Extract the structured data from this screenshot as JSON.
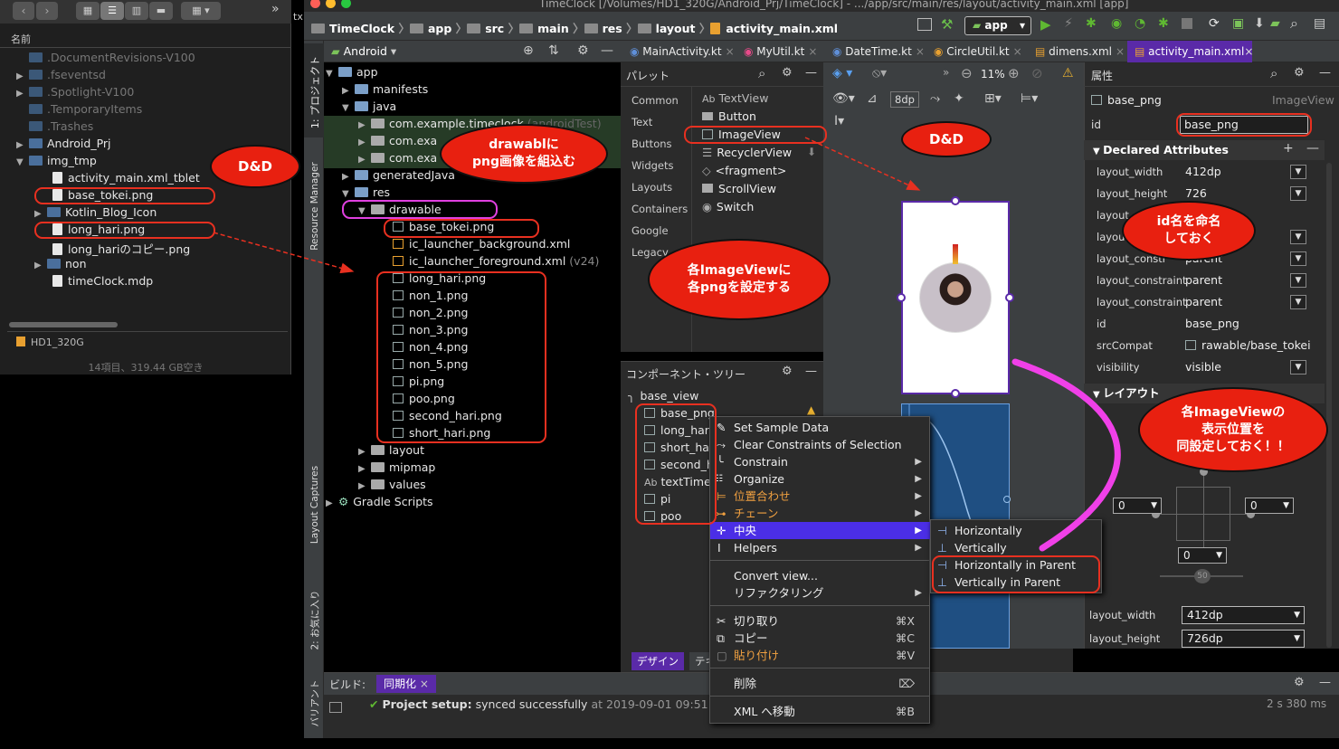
{
  "window_title": "TimeClock [/Volumes/HD1_320G/Android_Prj/TimeClock] - .../app/src/main/res/layout/activity_main.xml [app]",
  "finder": {
    "header": "名前",
    "items": [
      ".DocumentRevisions-V100",
      ".fseventsd",
      ".Spotlight-V100",
      ".TemporaryItems",
      ".Trashes",
      "Android_Prj",
      "img_tmp",
      "activity_main.xml_tblet",
      "base_tokei.png",
      "Kotlin_Blog_Icon",
      "long_hari.png",
      "long_hariのコピー.png",
      "non",
      "timeClock.mdp"
    ],
    "drive": "HD1_320G",
    "status": "14項目、319.44 GB空き",
    "tx": "tx"
  },
  "toolbar": {
    "project": "TimeClock",
    "crumbs": [
      "app",
      "src",
      "main",
      "res",
      "layout",
      "activity_main.xml"
    ],
    "run_config": "app"
  },
  "left_tabs": [
    "1: プロジェクト",
    "Resource Manager",
    "Layout Captures",
    "2: お気に入り",
    "バリアント"
  ],
  "project": {
    "view": "Android",
    "rows": [
      "app",
      "manifests",
      "java",
      "com.example.timeclock",
      "(androidTest)",
      "com.exa",
      "com.exa",
      "generatedJava",
      "res",
      "drawable",
      "base_tokei.png",
      "ic_launcher_background.xml",
      "ic_launcher_foreground.xml",
      "(v24)",
      "long_hari.png",
      "non_1.png",
      "non_2.png",
      "non_3.png",
      "non_4.png",
      "non_5.png",
      "pi.png",
      "poo.png",
      "second_hari.png",
      "short_hari.png",
      "layout",
      "mipmap",
      "values",
      "Gradle Scripts"
    ]
  },
  "tabs": [
    "MainActivity.kt",
    "MyUtil.kt",
    "DateTime.kt",
    "CircleUtil.kt",
    "dimens.xml",
    "activity_main.xml"
  ],
  "palette": {
    "title": "パレット",
    "categories": [
      "Common",
      "Text",
      "Buttons",
      "Widgets",
      "Layouts",
      "Containers",
      "Google",
      "Legacy"
    ],
    "items": [
      "TextView",
      "Button",
      "ImageView",
      "RecyclerView",
      "<fragment>",
      "ScrollView",
      "Switch"
    ],
    "ab": "Ab"
  },
  "design_toolbar": {
    "zoom": "11%",
    "margin": "8dp"
  },
  "component_tree": {
    "title": "コンポーネント・ツリー",
    "root": "base_view",
    "items": [
      "base_png",
      "long_hari",
      "short_hari",
      "second_hari",
      "textTime",
      "pi",
      "poo"
    ],
    "bottom_tabs": [
      "デザイン",
      "テキスト"
    ]
  },
  "context_menu": {
    "items": [
      {
        "label": "Set Sample Data"
      },
      {
        "label": "Clear Constraints of Selection"
      },
      {
        "label": "Constrain"
      },
      {
        "label": "Organize"
      },
      {
        "label": "位置合わせ"
      },
      {
        "label": "チェーン"
      },
      {
        "label": "中央"
      },
      {
        "label": "Helpers"
      },
      {
        "label": "Convert view..."
      },
      {
        "label": "リファクタリング"
      },
      {
        "label": "切り取り",
        "shortcut": "⌘X"
      },
      {
        "label": "コピー",
        "shortcut": "⌘C"
      },
      {
        "label": "貼り付け",
        "shortcut": "⌘V"
      },
      {
        "label": "削除",
        "shortcut": "⌦"
      },
      {
        "label": "XML へ移動",
        "shortcut": "⌘B"
      }
    ],
    "submenu": [
      "Horizontally",
      "Vertically",
      "Horizontally in Parent",
      "Vertically in Parent"
    ]
  },
  "attributes": {
    "title": "属性",
    "component": "base_png",
    "type": "ImageView",
    "id_label": "id",
    "id_value": "base_png",
    "declared": "Declared Attributes",
    "rows": [
      {
        "k": "layout_width",
        "v": "412dp"
      },
      {
        "k": "layout_height",
        "v": "726"
      },
      {
        "k": "layout",
        "v": ""
      },
      {
        "k": "layou",
        "v": ""
      },
      {
        "k": "layout_constr",
        "v": "parent"
      },
      {
        "k": "layout_constraintS",
        "v": "parent"
      },
      {
        "k": "layout_constraintT",
        "v": "parent"
      },
      {
        "k": "id",
        "v": "base_png"
      },
      {
        "k": "srcCompat",
        "v": "rawable/base_tokei"
      },
      {
        "k": "visibility",
        "v": "visible"
      }
    ],
    "layout_section": "レイアウト",
    "margins": [
      "0",
      "0",
      "0",
      "50"
    ],
    "lw": "412dp",
    "lh": "726dp",
    "lw_label": "layout_width",
    "lh_label": "layout_height"
  },
  "build": {
    "label": "ビルド:",
    "tab": "同期化",
    "message_bold": "Project setup:",
    "message": "synced successfully",
    "time": "at 2019-09-01 09:51",
    "duration": "2 s 380 ms"
  },
  "annotations": {
    "dd_left": "D&D",
    "drawable": "drawablに\npng画像を組込む",
    "dd_right": "D&D",
    "imageview": "各ImageViewに\n各pngを設定する",
    "idname": "id名を命名\nしておく",
    "position": "各ImageViewの\n表示位置を\n同設定しておく！！"
  }
}
